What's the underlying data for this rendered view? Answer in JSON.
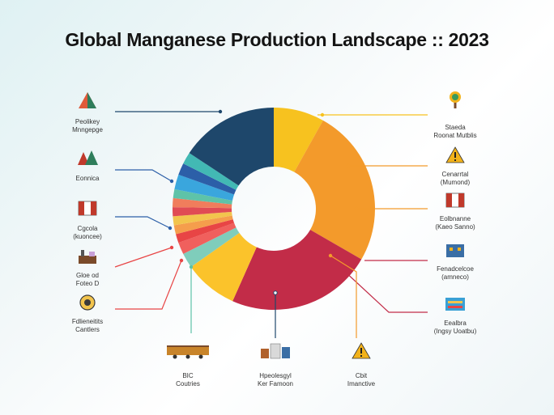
{
  "title": "Global Manganese Production Landscape :: 2023",
  "chart_data": {
    "type": "pie",
    "title": "Global Manganese Production Landscape :: 2023",
    "donut": true,
    "grid": false,
    "legend": "none",
    "slices": [
      {
        "value": 8.5,
        "color": "#f7c21f"
      },
      {
        "value": 26.5,
        "color": "#f39a2b"
      },
      {
        "value": 24.5,
        "color": "#c22c48"
      },
      {
        "value": 9.0,
        "color": "#fbc32b"
      },
      {
        "value": 2.5,
        "color": "#7fcdbb"
      },
      {
        "value": 2.0,
        "color": "#f0605d"
      },
      {
        "value": 1.5,
        "color": "#e84545"
      },
      {
        "value": 1.5,
        "color": "#f59e4c"
      },
      {
        "value": 1.5,
        "color": "#f2c44d"
      },
      {
        "value": 1.5,
        "color": "#e04b54"
      },
      {
        "value": 1.5,
        "color": "#f07d5c"
      },
      {
        "value": 1.5,
        "color": "#5ec3a8"
      },
      {
        "value": 2.5,
        "color": "#3aa6dd"
      },
      {
        "value": 2.0,
        "color": "#2c5fa8"
      },
      {
        "value": 2.0,
        "color": "#42b9b4"
      },
      {
        "value": 16.5,
        "color": "#1e476b"
      }
    ]
  },
  "labels": [
    {
      "id": "left-1",
      "line1": "Peolikey",
      "line2": "Mnngepge",
      "icon": "pyramid-icon",
      "color": "#e05a3a"
    },
    {
      "id": "left-2",
      "line1": "Eonnica",
      "line2": "",
      "icon": "mountains-icon",
      "color": "#c0392b"
    },
    {
      "id": "left-3",
      "line1": "Cgcola",
      "line2": "(kuoncee)",
      "icon": "flag-icon",
      "color": "#c0392b"
    },
    {
      "id": "left-4",
      "line1": "Gloe od",
      "line2": "Foteo D",
      "icon": "factory-icon",
      "color": "#7a4a2a"
    },
    {
      "id": "left-5",
      "line1": "Fdlieneitits",
      "line2": "Cantlers",
      "icon": "medal-icon",
      "color": "#3a3a3a"
    },
    {
      "id": "right-1",
      "line1": "Staeda",
      "line2": "Roonat Mutblis",
      "icon": "tree-icon",
      "color": "#3a9a5a"
    },
    {
      "id": "right-2",
      "line1": "Cenarrtal",
      "line2": "(Mumond)",
      "icon": "warning-icon",
      "color": "#f2b21b"
    },
    {
      "id": "right-3",
      "line1": "Eolbnanne",
      "line2": "(Kaeo Sanno)",
      "icon": "flag-icon",
      "color": "#c0392b"
    },
    {
      "id": "right-4",
      "line1": "Fenadcelcoe",
      "line2": "(amneco)",
      "icon": "building-icon",
      "color": "#3a6ea5"
    },
    {
      "id": "right-5",
      "line1": "Eealbra",
      "line2": "(Ingsy Uoatbu)",
      "icon": "truck-icon",
      "color": "#3aa0d5"
    },
    {
      "id": "bottom-1",
      "line1": "BIC",
      "line2": "Coutries",
      "icon": "train-icon",
      "color": "#c8842a"
    },
    {
      "id": "bottom-2",
      "line1": "Hpeolesgyl",
      "line2": "Ker Famoon",
      "icon": "city-icon",
      "color": "#b0602a"
    },
    {
      "id": "bottom-3",
      "line1": "Cbit",
      "line2": "Imanctive",
      "icon": "warning-icon",
      "color": "#f2b21b"
    }
  ]
}
